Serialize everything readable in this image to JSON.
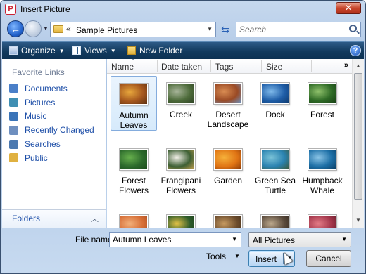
{
  "window": {
    "title": "Insert Picture",
    "close_label": "✕"
  },
  "address": {
    "breadcrumb_prefix": "«",
    "path": "Sample Pictures"
  },
  "search": {
    "placeholder": "Search"
  },
  "toolbar": {
    "organize": "Organize",
    "views": "Views",
    "new_folder": "New Folder",
    "help": "?"
  },
  "favorites": {
    "title": "Favorite Links",
    "items": [
      {
        "label": "Documents",
        "icon": "documents-icon",
        "color": "#4a7fc8"
      },
      {
        "label": "Pictures",
        "icon": "pictures-icon",
        "color": "#3f8fb3"
      },
      {
        "label": "Music",
        "icon": "music-icon",
        "color": "#3a74b8"
      },
      {
        "label": "Recently Changed",
        "icon": "recently-changed-icon",
        "color": "#6e8fbf"
      },
      {
        "label": "Searches",
        "icon": "searches-icon",
        "color": "#4c79b0"
      },
      {
        "label": "Public",
        "icon": "public-folder-icon",
        "color": "#e0b140"
      }
    ],
    "folders_label": "Folders"
  },
  "columns": [
    "Name",
    "Date taken",
    "Tags",
    "Size"
  ],
  "files": [
    {
      "name": "Autumn Leaves",
      "colors": [
        "#a5571e",
        "#e8a73c",
        "#5a2f10"
      ],
      "selected": true
    },
    {
      "name": "Creek",
      "colors": [
        "#4d6b3a",
        "#a8b59a",
        "#2e4224"
      ]
    },
    {
      "name": "Desert Landscape",
      "colors": [
        "#9a4a25",
        "#d98c52",
        "#6a97c9"
      ]
    },
    {
      "name": "Dock",
      "colors": [
        "#1f5ea8",
        "#7fb9ea",
        "#0e3a6e"
      ]
    },
    {
      "name": "Forest",
      "colors": [
        "#2f6b26",
        "#8fc16b",
        "#173f14"
      ]
    },
    {
      "name": "Forest Flowers",
      "colors": [
        "#2c6a2c",
        "#67b04d",
        "#1c4a1c"
      ]
    },
    {
      "name": "Frangipani Flowers",
      "colors": [
        "#3d5f33",
        "#f4f1ea",
        "#c4a04f"
      ]
    },
    {
      "name": "Garden",
      "colors": [
        "#e07414",
        "#f6b13a",
        "#8a3a08"
      ]
    },
    {
      "name": "Green Sea Turtle",
      "colors": [
        "#2a82b0",
        "#7bc3d8",
        "#3c5a3a"
      ]
    },
    {
      "name": "Humpback Whale",
      "colors": [
        "#1d6fa6",
        "#8ac4e6",
        "#0a3f66"
      ]
    },
    {
      "name": "",
      "colors": [
        "#d66d35",
        "#f2b07a",
        "#a24a20"
      ]
    },
    {
      "name": "",
      "colors": [
        "#2d5b2a",
        "#e3c248",
        "#1b3d19"
      ]
    },
    {
      "name": "",
      "colors": [
        "#6b4b2c",
        "#c69a61",
        "#3b2a18"
      ]
    },
    {
      "name": "",
      "colors": [
        "#5a4a3c",
        "#bca88c",
        "#2e241c"
      ]
    },
    {
      "name": "",
      "colors": [
        "#a2354a",
        "#e37b86",
        "#5b1a28"
      ]
    }
  ],
  "bottom": {
    "file_name_label": "File name:",
    "file_name_value": "Autumn Leaves",
    "file_type": "All Pictures",
    "tools": "Tools",
    "insert": "Insert",
    "cancel": "Cancel"
  }
}
